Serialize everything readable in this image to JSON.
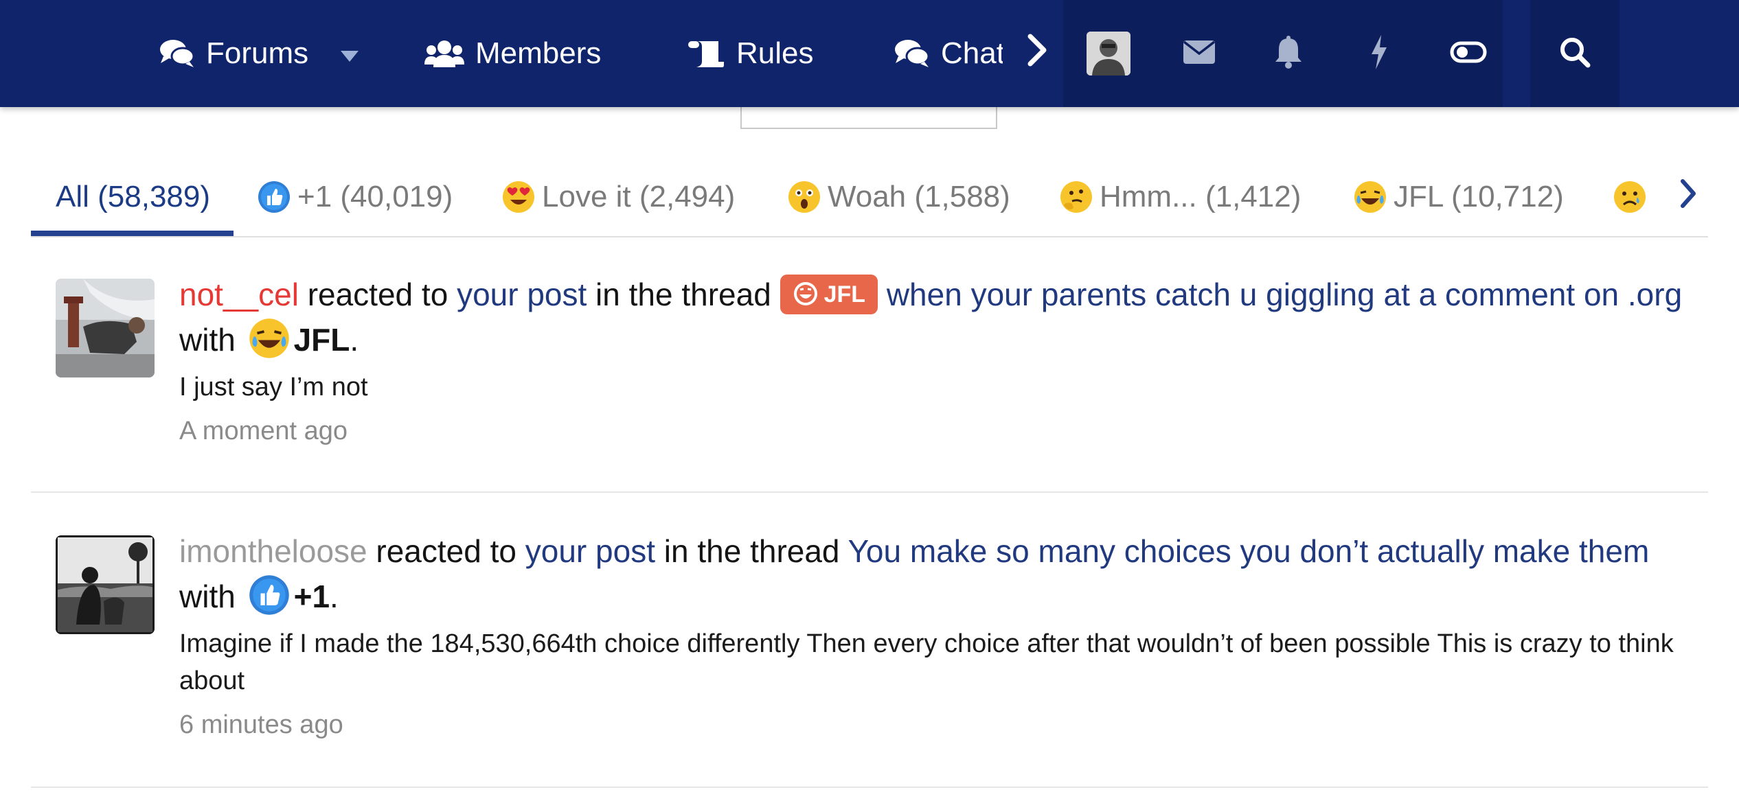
{
  "nav": {
    "forums": "Forums",
    "members": "Members",
    "rules": "Rules",
    "chat": "Chat"
  },
  "icons": {
    "forums": "chat-bubbles-icon",
    "members": "users-icon",
    "rules": "scroll-icon",
    "chat": "chat-bubbles-icon",
    "more": "chevron-right-icon",
    "mail": "envelope-icon",
    "alerts": "bell-icon",
    "whatsnew": "bolt-icon",
    "toggle": "toggle-icon",
    "search": "search-icon"
  },
  "colors": {
    "nav_bg": "#0f246b",
    "link": "#20397f",
    "active_tab": "#1c3b86",
    "badge": "#e8664a",
    "user_red": "#e53935"
  },
  "tabs": [
    {
      "label": "All (58,389)"
    },
    {
      "label": "+1 (40,019)"
    },
    {
      "label": "Love it (2,494)"
    },
    {
      "label": "Woah (1,588)"
    },
    {
      "label": "Hmm... (1,412)"
    },
    {
      "label": "JFL (10,712)"
    }
  ],
  "items": [
    {
      "user": "not__cel",
      "reacted_to": " reacted to ",
      "your_post": "your post",
      "in_thread": " in the thread ",
      "badge": "JFL",
      "thread": "when your parents catch u giggling at a comment on .org",
      "with": " with ",
      "reaction": "JFL",
      "period": ".",
      "snippet": "I just say I’m not",
      "time": "A moment ago"
    },
    {
      "user": "imontheloose",
      "reacted_to": " reacted to ",
      "your_post": "your post",
      "in_thread": " in the thread ",
      "thread": "You make so many choices you don’t actually make them",
      "with": " with ",
      "reaction": "+1",
      "period": ".",
      "snippet": "Imagine if I made the 184,530,664th choice differently Then every choice after that wouldn’t of been possible This is crazy to think about",
      "time": "6 minutes ago"
    }
  ]
}
